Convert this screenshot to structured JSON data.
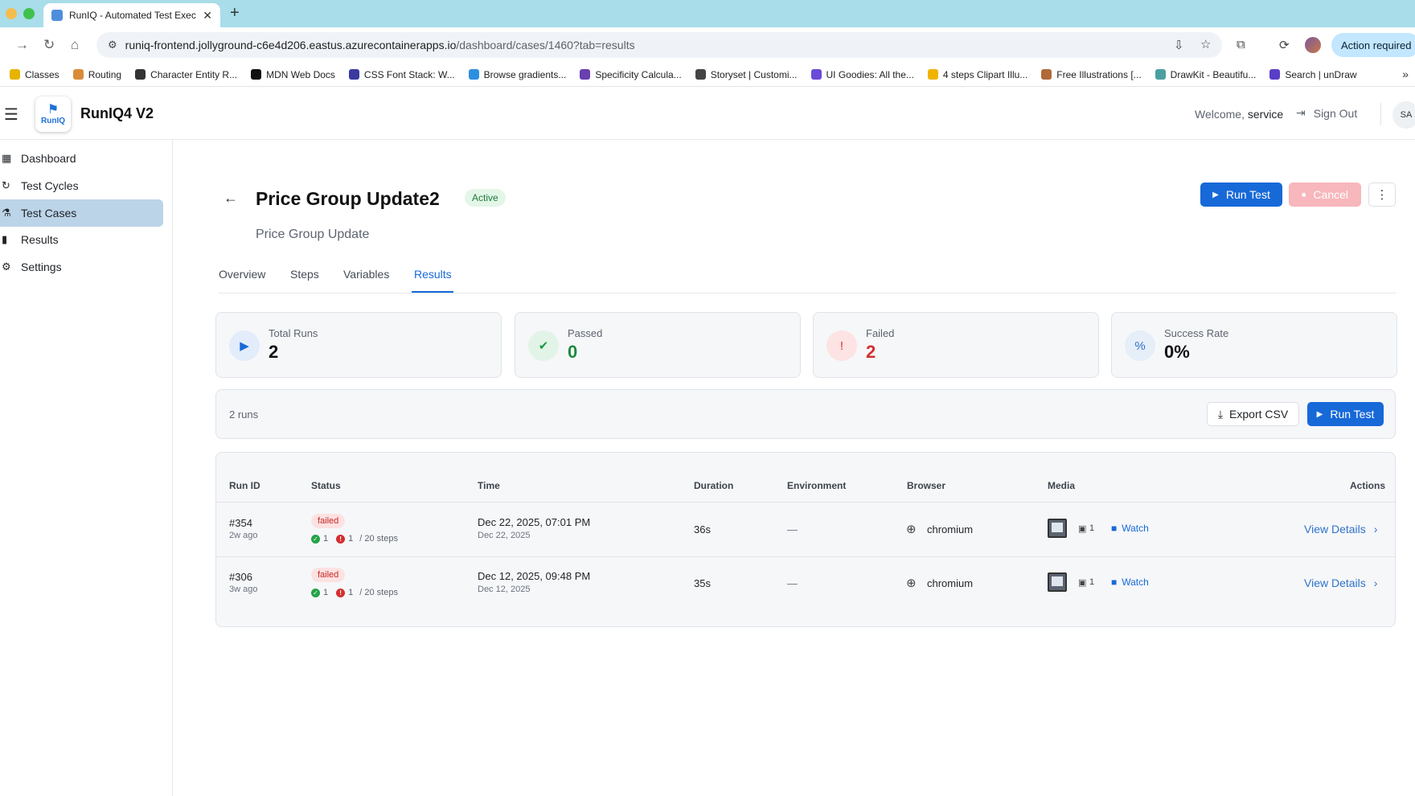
{
  "browser": {
    "tab_title": "RunIQ - Automated Test Exec",
    "url_host": "runiq-frontend.jollyground-c6e4d206.eastus.azurecontainerapps.io",
    "url_path": "/dashboard/cases/1460?tab=results",
    "action_required": "Action required",
    "bookmarks": [
      {
        "label": "Classes",
        "color": "#e6b400"
      },
      {
        "label": "Routing",
        "color": "#d98c3a"
      },
      {
        "label": "Character Entity R...",
        "color": "#333333"
      },
      {
        "label": "MDN Web Docs",
        "color": "#111111"
      },
      {
        "label": "CSS Font Stack: W...",
        "color": "#3a3aa0"
      },
      {
        "label": "Browse gradients...",
        "color": "#2e8fe0"
      },
      {
        "label": "Specificity Calcula...",
        "color": "#6a3fb0"
      },
      {
        "label": "Storyset | Customi...",
        "color": "#444444"
      },
      {
        "label": "UI Goodies: All the...",
        "color": "#6a4bd8"
      },
      {
        "label": "4 steps Clipart Illu...",
        "color": "#f0b400"
      },
      {
        "label": "Free Illustrations [...",
        "color": "#b06a3a"
      },
      {
        "label": "DrawKit - Beautifu...",
        "color": "#4aa0a0"
      },
      {
        "label": "Search | unDraw",
        "color": "#5a3ec8"
      }
    ]
  },
  "header": {
    "logo_text": "RunIQ",
    "app_name": "RunIQ4 V2",
    "welcome_prefix": "Welcome,",
    "username": "service",
    "sign_out": "Sign Out",
    "avatar_initials": "SA"
  },
  "sidebar": {
    "items": [
      {
        "label": "Dashboard",
        "icon": "grid-icon",
        "glyph": "▦",
        "active": false
      },
      {
        "label": "Test Cycles",
        "icon": "refresh-icon",
        "glyph": "↻",
        "active": false
      },
      {
        "label": "Test Cases",
        "icon": "flask-icon",
        "glyph": "⚗",
        "active": true
      },
      {
        "label": "Results",
        "icon": "bar-chart-icon",
        "glyph": "▮",
        "active": false
      },
      {
        "label": "Settings",
        "icon": "gear-icon",
        "glyph": "⚙",
        "active": false
      }
    ]
  },
  "case": {
    "title": "Price Group Update2",
    "status": "Active",
    "subtitle": "Price Group Update",
    "run_test": "Run Test",
    "cancel": "Cancel"
  },
  "tabs": [
    {
      "label": "Overview",
      "active": false
    },
    {
      "label": "Steps",
      "active": false
    },
    {
      "label": "Variables",
      "active": false
    },
    {
      "label": "Results",
      "active": true
    }
  ],
  "stats": [
    {
      "label": "Total Runs",
      "value": "2",
      "icon": "play-icon",
      "glyph": "▶",
      "bg": "#e3ecfb",
      "fg": "#1769d8",
      "value_color": "#111111"
    },
    {
      "label": "Passed",
      "value": "0",
      "icon": "check-circle-icon",
      "glyph": "✔",
      "bg": "#e2f4e7",
      "fg": "#1e9a45",
      "value_color": "#1e8a3c"
    },
    {
      "label": "Failed",
      "value": "2",
      "icon": "alert-circle-icon",
      "glyph": "!",
      "bg": "#fde3e3",
      "fg": "#d32f2f",
      "value_color": "#d32f2f"
    },
    {
      "label": "Success Rate",
      "value": "0%",
      "icon": "percent-icon",
      "glyph": "%",
      "bg": "#e6eef8",
      "fg": "#2f73c9",
      "value_color": "#111111"
    }
  ],
  "runs_bar": {
    "count_text": "2 runs",
    "export": "Export CSV",
    "run_test": "Run Test"
  },
  "table": {
    "columns": [
      "Run ID",
      "Status",
      "Time",
      "Duration",
      "Environment",
      "Browser",
      "Media",
      "Actions"
    ],
    "rows": [
      {
        "id": "#354",
        "ago": "2w ago",
        "status": "failed",
        "passed_steps": "1",
        "failed_steps": "1",
        "steps_total": "/ 20 steps",
        "time": "Dec 22, 2025, 07:01 PM",
        "date": "Dec 22, 2025",
        "duration": "36s",
        "environment": "—",
        "browser": "chromium",
        "image_count": "1",
        "watch": "Watch",
        "view": "View Details"
      },
      {
        "id": "#306",
        "ago": "3w ago",
        "status": "failed",
        "passed_steps": "1",
        "failed_steps": "1",
        "steps_total": "/ 20 steps",
        "time": "Dec 12, 2025, 09:48 PM",
        "date": "Dec 12, 2025",
        "duration": "35s",
        "environment": "—",
        "browser": "chromium",
        "image_count": "1",
        "watch": "Watch",
        "view": "View Details"
      }
    ]
  }
}
